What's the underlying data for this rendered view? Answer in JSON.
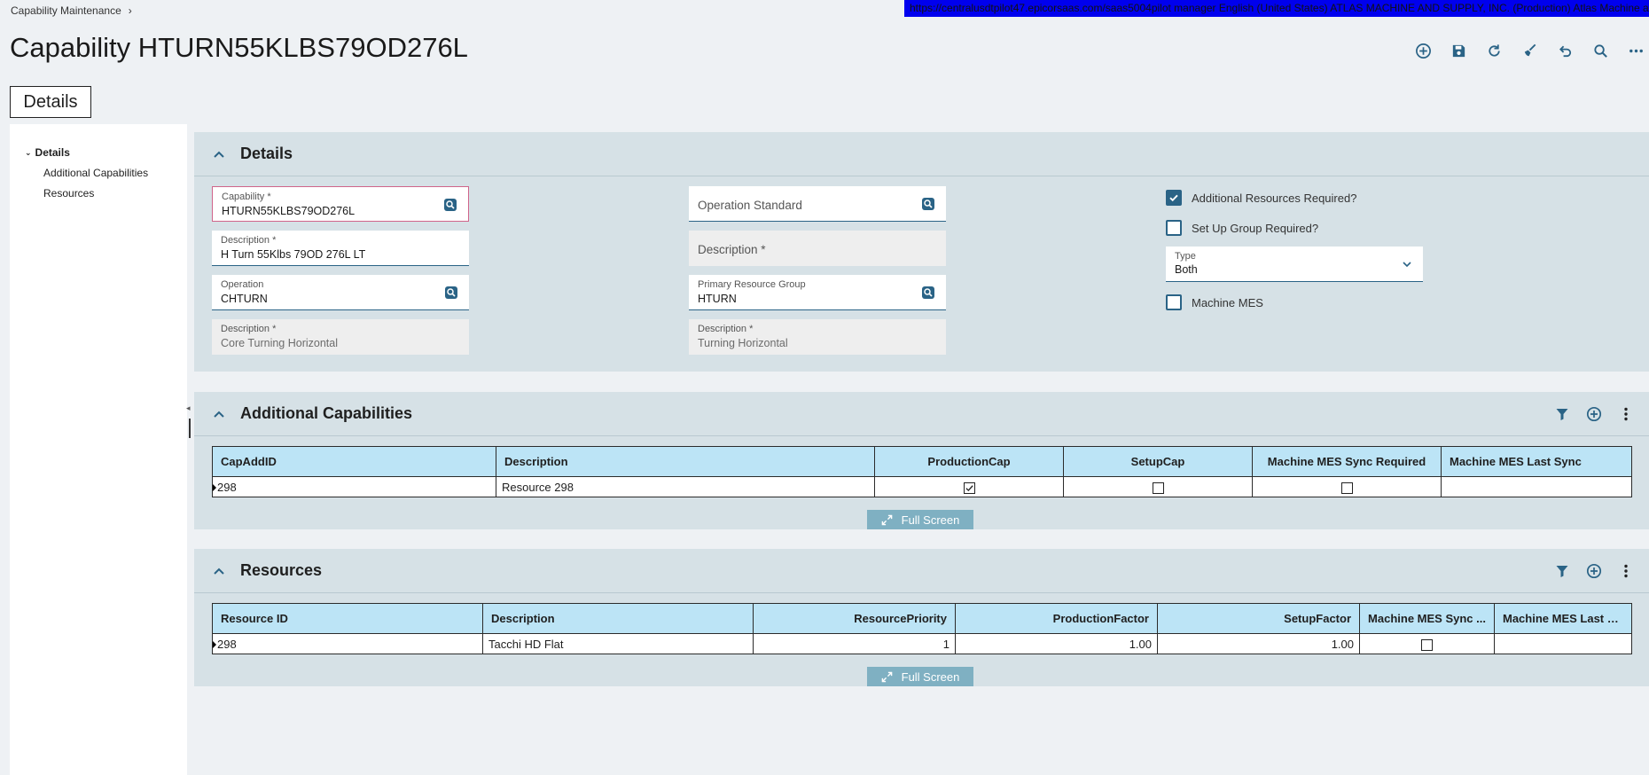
{
  "breadcrumb": {
    "item": "Capability Maintenance"
  },
  "status_bar": {
    "text": "https://centralusdtpilot47.epicorsaas.com/saas5004pilot   manager   English (United States)   ATLAS MACHINE AND SUPPLY, INC. (Production)   Atlas Machine and Supply"
  },
  "page_title": "Capability HTURN55KLBS79OD276L",
  "tab_label": "Details",
  "nav": {
    "root": "Details",
    "children": [
      "Additional Capabilities",
      "Resources"
    ]
  },
  "details": {
    "title": "Details",
    "capability": {
      "label": "Capability *",
      "value": "HTURN55KLBS79OD276L"
    },
    "description": {
      "label": "Description *",
      "value": "H Turn 55Klbs 79OD 276L LT"
    },
    "operation": {
      "label": "Operation",
      "value": "CHTURN"
    },
    "operation_description": {
      "label": "Description *",
      "value": "Core Turning Horizontal"
    },
    "operation_standard": {
      "label": "Operation Standard"
    },
    "op_std_description": {
      "label": "Description *"
    },
    "primary_resource_group": {
      "label": "Primary Resource Group",
      "value": "HTURN"
    },
    "resource_group_description": {
      "label": "Description *",
      "value": "Turning Horizontal"
    },
    "additional_resources_required": {
      "label": "Additional Resources Required?",
      "checked": true
    },
    "setup_group_required": {
      "label": "Set Up Group Required?",
      "checked": false
    },
    "type": {
      "label": "Type",
      "value": "Both"
    },
    "machine_mes": {
      "label": "Machine MES",
      "checked": false
    }
  },
  "additional_capabilities": {
    "title": "Additional Capabilities",
    "columns": [
      "CapAddID",
      "Description",
      "ProductionCap",
      "SetupCap",
      "Machine MES Sync Required",
      "Machine MES Last Sync"
    ],
    "rows": [
      {
        "id": "298",
        "description": "Resource 298",
        "production_cap": true,
        "setup_cap": false,
        "mes_sync_required": false,
        "mes_last_sync": ""
      }
    ],
    "full_screen_label": "Full Screen"
  },
  "resources": {
    "title": "Resources",
    "columns": [
      "Resource ID",
      "Description",
      "ResourcePriority",
      "ProductionFactor",
      "SetupFactor",
      "Machine MES Sync ...",
      "Machine MES Last S..."
    ],
    "rows": [
      {
        "id": "298",
        "description": "Tacchi HD Flat",
        "priority": "1",
        "production_factor": "1.00",
        "setup_factor": "1.00",
        "mes_sync": false,
        "mes_last_sync": ""
      }
    ],
    "full_screen_label": "Full Screen"
  },
  "colors": {
    "accent": "#2a6386",
    "panel": "#d6e1e6",
    "grid_header": "#bce4f6",
    "status_strip": "#0000ee",
    "full_screen_button": "#7fb0c2"
  }
}
